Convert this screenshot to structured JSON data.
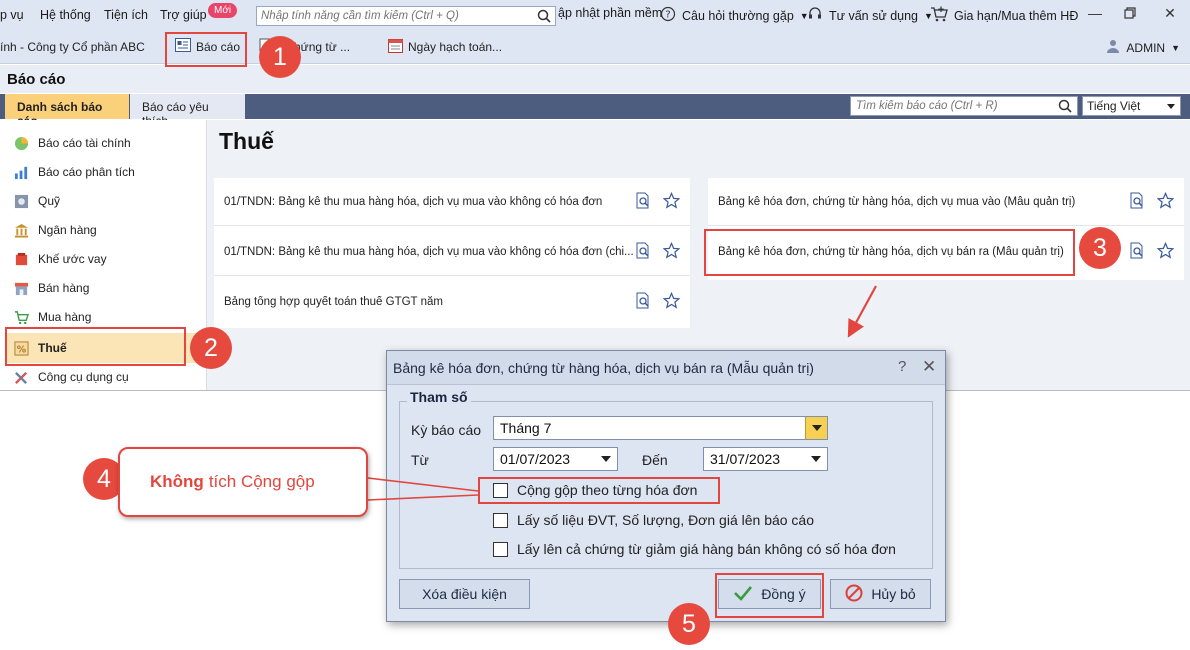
{
  "menubar": {
    "items": [
      "p vụ",
      "Hệ thống",
      "Tiện ích",
      "Trợ giúp"
    ],
    "new_badge": "Mới",
    "feature_search_placeholder": "Nhập tính năng cần tìm kiếm (Ctrl + Q)",
    "update_label": "ập nhật phần mềm",
    "faq_label": "Câu hỏi thường gặp",
    "support_label": "Tư vấn sử dụng",
    "renew_label": "Gia hạn/Mua thêm HĐ"
  },
  "toolbar": {
    "company": "ính - Công ty Cổ phần ABC",
    "report_button": "Báo cáo",
    "documents_button": "n chứng từ ...",
    "posting_date_button": "Ngày hạch toán...",
    "user": "ADMIN"
  },
  "page": {
    "title": "Báo cáo",
    "tabs": [
      "Danh sách báo cáo",
      "Báo cáo yêu thích"
    ],
    "report_search_placeholder": "Tìm kiếm báo cáo (Ctrl + R)",
    "language": "Tiếng Việt"
  },
  "sidebar": {
    "items": [
      {
        "label": "Báo cáo tài chính",
        "icon": "pie-chart-icon"
      },
      {
        "label": "Báo cáo phân tích",
        "icon": "bar-chart-icon"
      },
      {
        "label": "Quỹ",
        "icon": "safe-icon"
      },
      {
        "label": "Ngân hàng",
        "icon": "bank-icon"
      },
      {
        "label": "Khế ước vay",
        "icon": "loan-icon"
      },
      {
        "label": "Bán hàng",
        "icon": "store-icon"
      },
      {
        "label": "Mua hàng",
        "icon": "cart-icon"
      },
      {
        "label": "Thuế",
        "icon": "tax-icon"
      },
      {
        "label": "Công cụ dụng cụ",
        "icon": "tools-icon"
      }
    ]
  },
  "main": {
    "section_title": "Thuế",
    "left_reports": [
      "01/TNDN: Bảng kê thu mua hàng hóa, dịch vụ mua vào không có hóa đơn",
      "01/TNDN: Bảng kê thu mua hàng hóa, dịch vụ mua vào không có hóa đơn (chi...",
      "Bảng tổng hợp quyết toán thuế GTGT năm"
    ],
    "right_reports": [
      "Bảng kê hóa đơn, chứng từ hàng hóa, dịch vụ mua vào (Mẫu quản trị)",
      "Bảng kê hóa đơn, chứng từ hàng hóa, dịch vụ bán ra (Mẫu quản trị)"
    ]
  },
  "dialog": {
    "title": "Bảng kê hóa đơn, chứng từ hàng hóa, dịch vụ bán ra (Mẫu quản trị)",
    "help": "?",
    "close": "✕",
    "params_legend": "Tham số",
    "period_label": "Kỳ báo cáo",
    "period_value": "Tháng 7",
    "from_label": "Từ",
    "from_value": "01/07/2023",
    "to_label": "Đến",
    "to_value": "31/07/2023",
    "options": [
      "Cộng gộp theo từng hóa đơn",
      "Lấy số liệu ĐVT, Số lượng, Đơn giá lên báo cáo",
      "Lấy lên cả chứng từ giảm giá hàng bán không có số hóa đơn"
    ],
    "clear_button": "Xóa điều kiện",
    "ok_button": "Đồng ý",
    "cancel_button": "Hủy bỏ"
  },
  "annotations": {
    "steps": [
      "1",
      "2",
      "3",
      "4",
      "5"
    ],
    "callout_bold": "Không",
    "callout_rest": "tích Cộng gộp",
    "accent_color": "#e2463f"
  }
}
